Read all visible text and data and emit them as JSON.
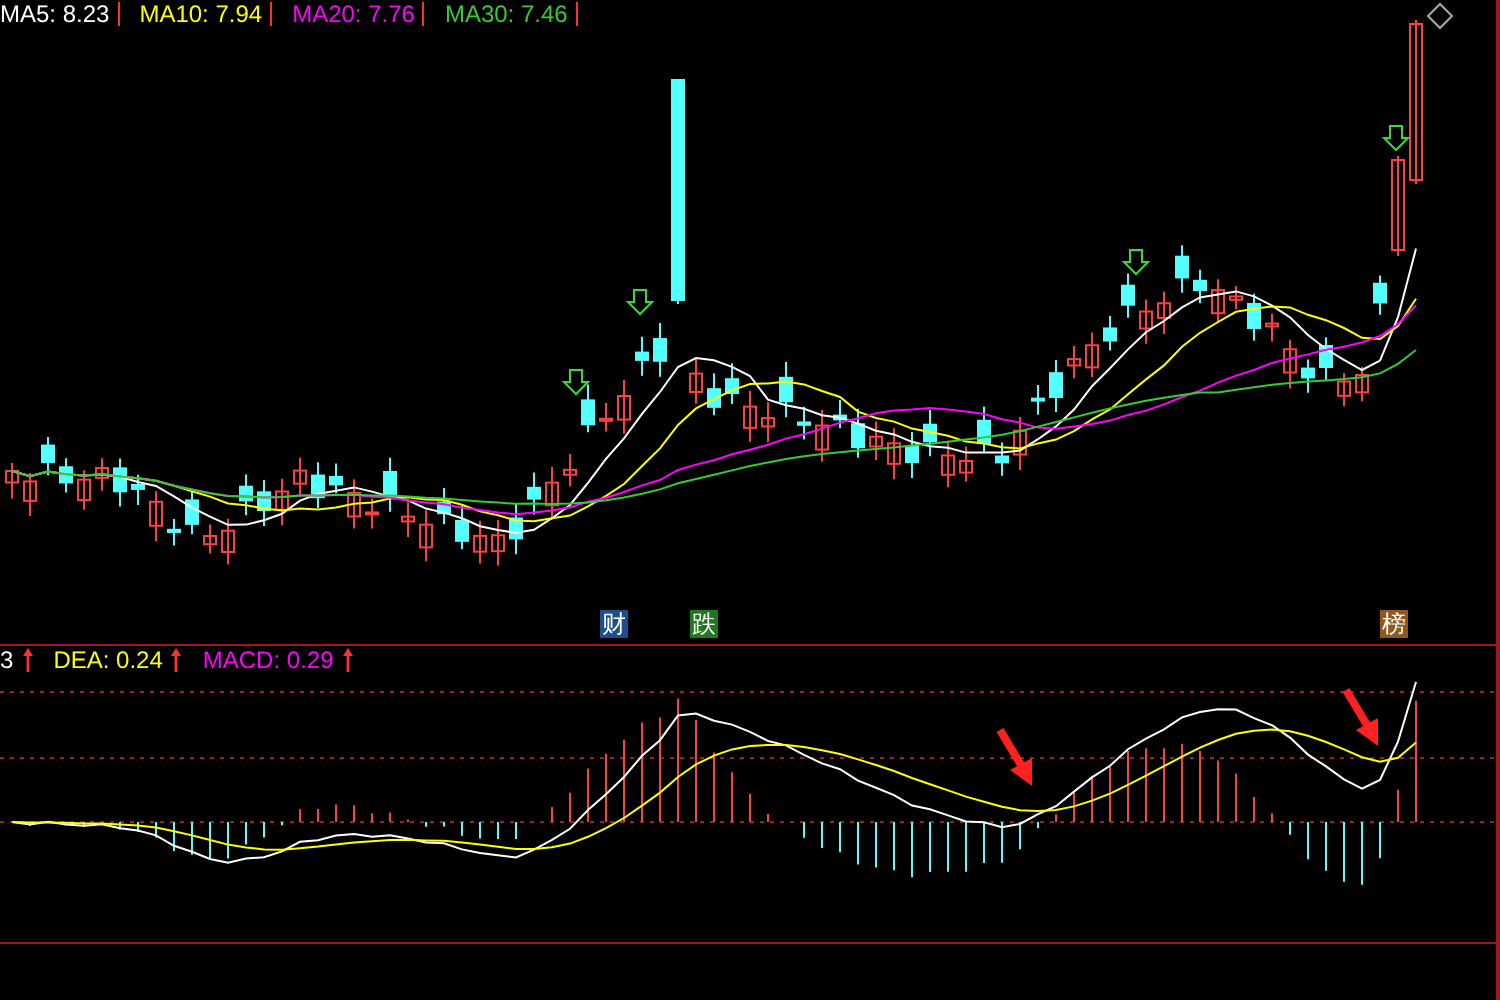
{
  "price_panel": {
    "legend": [
      {
        "text": "MA5: 8.23",
        "color": "#ffffff"
      },
      {
        "text": "MA10: 7.94",
        "color": "#ffff00"
      },
      {
        "text": "MA20: 7.76",
        "color": "#ff00ff"
      },
      {
        "text": "MA30: 7.46",
        "color": "#33cc33"
      }
    ],
    "badges": [
      {
        "text": "财",
        "color": "#1c4f8c"
      },
      {
        "text": "跌",
        "color": "#1f7a1f"
      },
      {
        "text": "榜",
        "color": "#8c5a1c"
      }
    ]
  },
  "macd_panel": {
    "legend": [
      {
        "text": "3",
        "color": "#ffffff"
      },
      {
        "text": "DEA: 0.24",
        "color": "#ffff00"
      },
      {
        "text": "MACD: 0.29",
        "color": "#ff00ff"
      }
    ]
  }
}
